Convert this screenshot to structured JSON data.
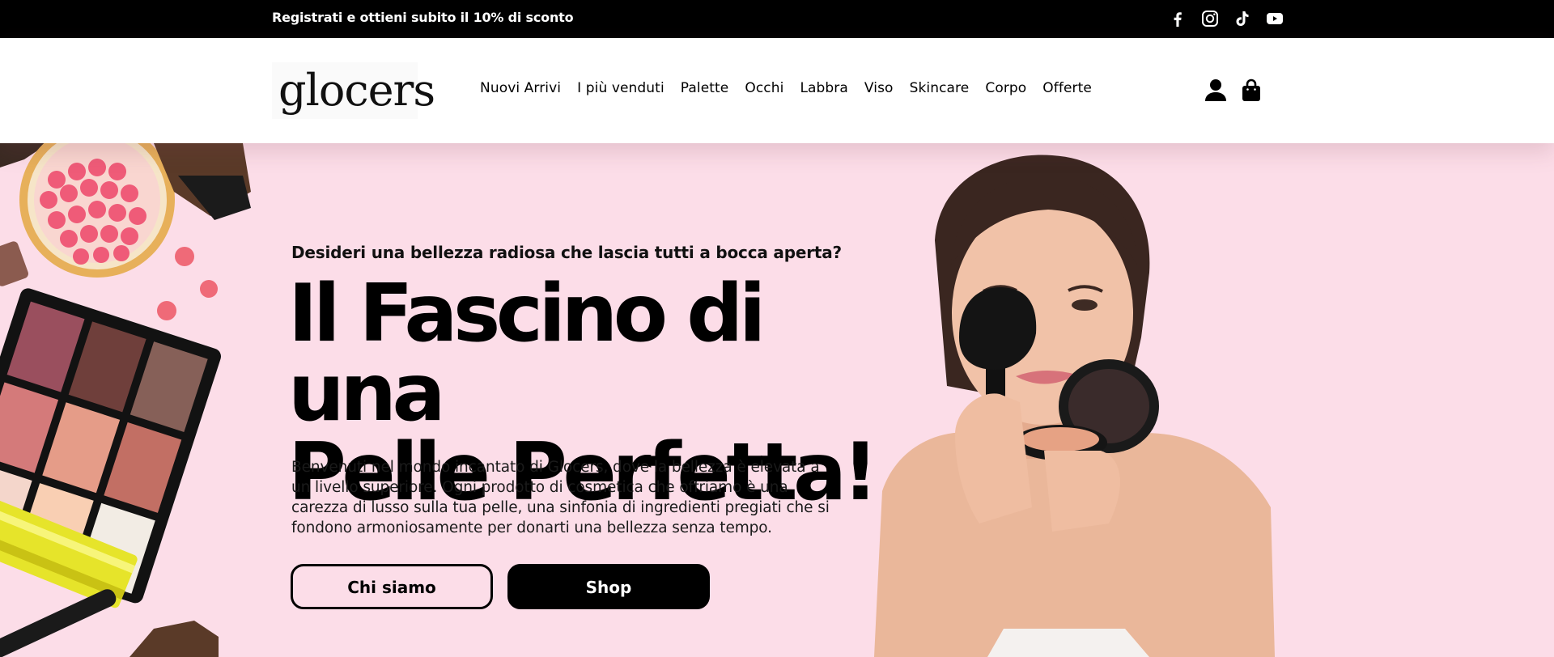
{
  "topbar": {
    "promo": "Registrati e ottieni subito il 10% di sconto",
    "socials": [
      "facebook-icon",
      "instagram-icon",
      "tiktok-icon",
      "youtube-icon"
    ]
  },
  "header": {
    "logo": "glocers",
    "nav": [
      "Nuovi Arrivi",
      "I più venduti",
      "Palette",
      "Occhi",
      "Labbra",
      "Viso",
      "Skincare",
      "Corpo",
      "Offerte"
    ],
    "icons": [
      "account-icon",
      "shopping-bag-icon"
    ]
  },
  "hero": {
    "subtitle": "Desideri una bellezza radiosa che lascia tutti a bocca aperta?",
    "title_line1": "Il Fascino di una",
    "title_line2": "Pelle Perfetta!",
    "text": "Benvenuti nel mondo incantato di Glocers, dove la bellezza è elevata a un livello superiore. Ogni prodotto di cosmetica che offriamo è una carezza di lusso sulla tua pelle, una sinfonia di ingredienti pregiati che si fondono armoniosamente per donarti una bellezza senza tempo.",
    "button_about": "Chi siamo",
    "button_shop": "Shop"
  },
  "colors": {
    "topbar_bg": "#000000",
    "hero_bg": "#fcdde8",
    "button_dark": "#000000"
  }
}
